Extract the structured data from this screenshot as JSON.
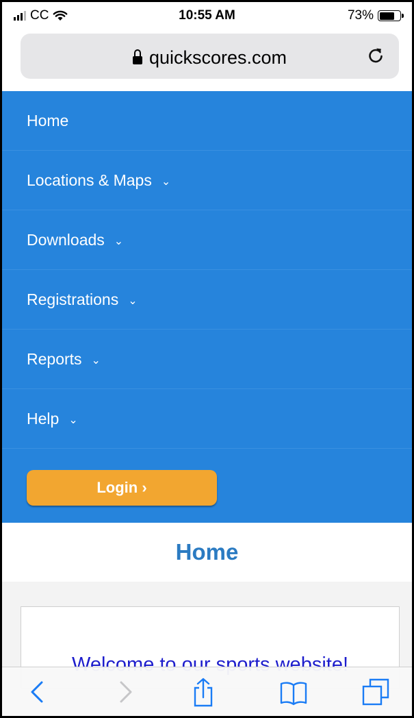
{
  "status_bar": {
    "carrier": "CC",
    "time": "10:55 AM",
    "battery_percent": "73%",
    "battery_level": 0.73,
    "icons": [
      "signal-icon",
      "wifi-icon",
      "battery-icon"
    ]
  },
  "url_bar": {
    "host": "quickscores.com",
    "icons": [
      "lock-icon",
      "reload-icon"
    ]
  },
  "nav": {
    "items": [
      {
        "label": "Home",
        "has_submenu": false
      },
      {
        "label": "Locations & Maps",
        "has_submenu": true
      },
      {
        "label": "Downloads",
        "has_submenu": true
      },
      {
        "label": "Registrations",
        "has_submenu": true
      },
      {
        "label": "Reports",
        "has_submenu": true
      },
      {
        "label": "Help",
        "has_submenu": true
      }
    ],
    "chevron": "⌄",
    "login_label": "Login ›"
  },
  "main": {
    "heading": "Home",
    "welcome_text": "Welcome to our sports website!"
  },
  "toolbar": {
    "icons": [
      "back-icon",
      "forward-icon",
      "share-icon",
      "bookmarks-icon",
      "tabs-icon"
    ]
  },
  "colors": {
    "nav_bg": "#2684dc",
    "login_bg": "#f2a630",
    "heading_color": "#2b7bc2",
    "welcome_color": "#1d1dcc",
    "ios_blue": "#1a7cf5"
  }
}
